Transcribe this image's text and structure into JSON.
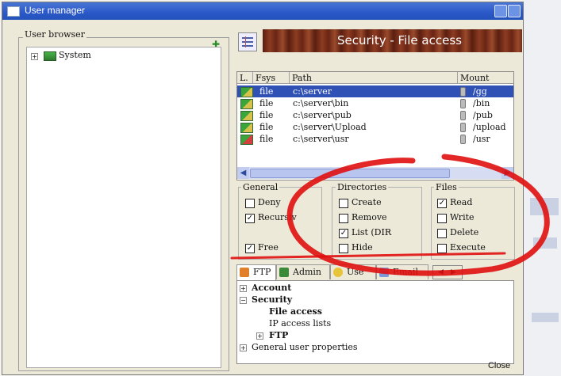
{
  "window": {
    "title": "User manager"
  },
  "user_browser": {
    "label": "User browser",
    "tree": [
      {
        "label": "System",
        "icon": "users-icon"
      }
    ]
  },
  "header": {
    "title": "Security - File access"
  },
  "file_list": {
    "columns": [
      "L.",
      "Fsys",
      "Path",
      "Mount point"
    ],
    "rows": [
      {
        "fsys": "file",
        "path": "c:\\server",
        "mount": "/gg",
        "selected": true
      },
      {
        "fsys": "file",
        "path": "c:\\server\\bin",
        "mount": "/bin",
        "selected": false
      },
      {
        "fsys": "file",
        "path": "c:\\server\\pub",
        "mount": "/pub",
        "selected": false
      },
      {
        "fsys": "file",
        "path": "c:\\server\\Upload",
        "mount": "/upload",
        "selected": false
      },
      {
        "fsys": "file",
        "path": "c:\\server\\usr",
        "mount": "/usr",
        "selected": false
      }
    ]
  },
  "general": {
    "title": "General",
    "deny": {
      "label": "Deny",
      "checked": false
    },
    "recursive": {
      "label": "Recursiv",
      "checked": true
    },
    "free": {
      "label": "Free",
      "checked": true
    }
  },
  "directories": {
    "title": "Directories",
    "create": {
      "label": "Create",
      "checked": false
    },
    "remove": {
      "label": "Remove",
      "checked": false
    },
    "list": {
      "label": "List (DIR",
      "checked": true
    },
    "hide": {
      "label": "Hide",
      "checked": false
    }
  },
  "files": {
    "title": "Files",
    "read": {
      "label": "Read",
      "checked": true
    },
    "write": {
      "label": "Write",
      "checked": false
    },
    "delete": {
      "label": "Delete",
      "checked": false
    },
    "execute": {
      "label": "Execute",
      "checked": false
    }
  },
  "tabs": [
    {
      "label": "FTP",
      "icon": "ftp-icon",
      "active": true
    },
    {
      "label": "Admin",
      "icon": "admin-icon",
      "active": false
    },
    {
      "label": "Use",
      "icon": "user-icon",
      "active": false
    },
    {
      "label": "Email",
      "icon": "email-icon",
      "active": false
    }
  ],
  "settings_tree": {
    "account": "Account",
    "security": "Security",
    "file_access": "File access",
    "ip_access_lists": "IP access lists",
    "ftp": "FTP",
    "general_user_properties": "General user properties"
  },
  "close_button": "Close",
  "colors": {
    "selection": "#2f51b5",
    "banner": "#7a2e18",
    "annotation": "#e01010"
  }
}
